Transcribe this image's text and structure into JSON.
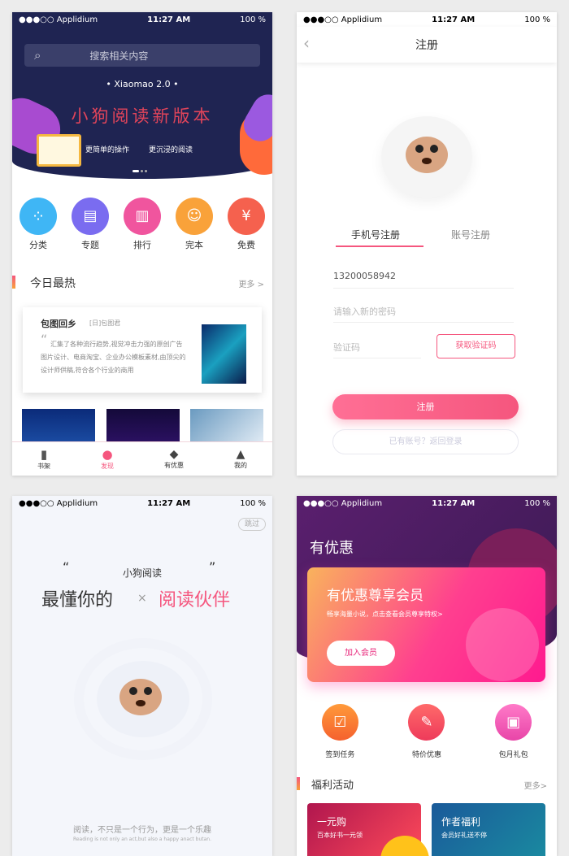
{
  "status": {
    "carrier": "●●●○○ Applidium",
    "time": "11:27 AM",
    "battery": "100 %"
  },
  "home": {
    "search_placeholder": "搜索相关内容",
    "banner": {
      "subtitle": "•  Xiaomao   2.0  •",
      "title": "小狗阅读新版本",
      "tag1": "更简单的操作",
      "tag2": "更沉浸的阅读"
    },
    "categories": [
      {
        "label": "分类",
        "color": "#3fb6f5"
      },
      {
        "label": "专题",
        "color": "#7a6cf0"
      },
      {
        "label": "排行",
        "color": "#f0559e"
      },
      {
        "label": "完本",
        "color": "#f9a23a"
      },
      {
        "label": "免费",
        "color": "#f5614e"
      }
    ],
    "section_title": "今日最热",
    "more": "更多 >",
    "book": {
      "title": "包图回乡",
      "author": "[日]包图君",
      "quote": "“",
      "desc": "汇集了各种流行趋势,视觉冲击力强的原创广告图片设计、电商淘宝、企业办公模板素材,由顶尖的设计师供稿,符合各个行业的商用"
    },
    "tabs": [
      {
        "label": "书架",
        "icon": "book-icon"
      },
      {
        "label": "发现",
        "icon": "discover-icon",
        "active": true
      },
      {
        "label": "有优惠",
        "icon": "vip-icon"
      },
      {
        "label": "我的",
        "icon": "profile-icon"
      }
    ]
  },
  "register": {
    "title": "注册",
    "back": "‹",
    "tab_phone": "手机号注册",
    "tab_account": "账号注册",
    "phone_value": "13200058942",
    "password_placeholder": "请输入新的密码",
    "code_placeholder": "验证码",
    "get_code": "获取验证码",
    "submit": "注册",
    "login_link": "已有账号？返回登录"
  },
  "splash": {
    "skip": "跳过",
    "small": "小狗阅读",
    "line_left": "最懂你的",
    "times": "×",
    "line_right": "阅读伙伴",
    "open_quote": "“",
    "close_quote": "”",
    "slogan": "阅读，不只是一个行为，更是一个乐趣",
    "slogan_en": "Reading is not only an act,but also a happy anact butan."
  },
  "vip": {
    "title": "有优惠",
    "card_title": "有优惠尊享会员",
    "card_sub": "畅享海量小说，点击查看会员尊享特权>",
    "join": "加入会员",
    "actions": [
      {
        "label": "签到任务",
        "icon": "calendar-check-icon"
      },
      {
        "label": "特价优惠",
        "icon": "tag-icon"
      },
      {
        "label": "包月礼包",
        "icon": "gift-icon"
      }
    ],
    "section_title": "福利活动",
    "more": "更多>",
    "promos": [
      {
        "title": "一元购",
        "sub": "百本好书一元领"
      },
      {
        "title": "作者福利",
        "sub": "会员好礼送不停"
      }
    ]
  },
  "colors": {
    "accent": "#f5567e",
    "navy": "#1f2452",
    "purple": "#5a1f6e"
  }
}
